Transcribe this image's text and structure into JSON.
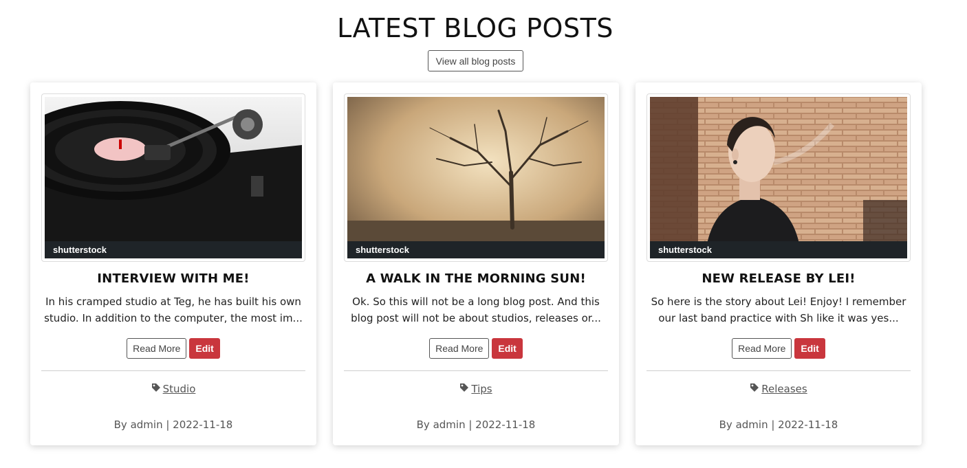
{
  "page": {
    "heading": "LATEST BLOG POSTS",
    "view_all_label": "View all blog posts"
  },
  "colors": {
    "edit_button": "#c9363d",
    "tag_icon": "#555555"
  },
  "posts": [
    {
      "title": "INTERVIEW WITH ME!",
      "excerpt": "In his cramped studio at Teg, he has built his own studio. In addition to the computer, the most im...",
      "read_more_label": "Read More",
      "edit_label": "Edit",
      "tag": "Studio",
      "byline": "By admin | 2022-11-18",
      "image_watermark": "shutterstock",
      "image_subject": "turntable-photo"
    },
    {
      "title": "A WALK IN THE MORNING SUN!",
      "excerpt": "Ok. So this will not be a long blog post. And this blog post will not be about studios, releases or...",
      "read_more_label": "Read More",
      "edit_label": "Edit",
      "tag": "Tips",
      "byline": "By admin | 2022-11-18",
      "image_watermark": "shutterstock",
      "image_subject": "misty-tree-photo"
    },
    {
      "title": "NEW RELEASE BY LEI!",
      "excerpt": "So here is the story about Lei! Enjoy! I remember our last band practice with Sh like it was yes...",
      "read_more_label": "Read More",
      "edit_label": "Edit",
      "tag": "Releases",
      "byline": "By admin | 2022-11-18",
      "image_watermark": "shutterstock",
      "image_subject": "portrait-brick-wall-photo"
    }
  ]
}
